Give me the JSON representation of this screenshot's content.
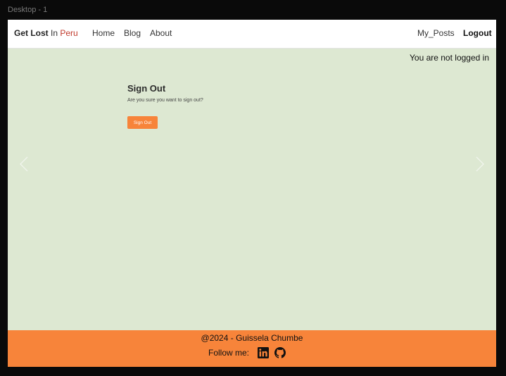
{
  "frame": {
    "label": "Desktop - 1"
  },
  "navbar": {
    "brand_part1": "Get Lost",
    "brand_part2": " In ",
    "brand_part3": "Peru",
    "links": [
      "Home",
      "Blog",
      "About"
    ],
    "my_posts": "My_Posts",
    "logout": "Logout"
  },
  "status_text": "You are not logged in",
  "signout": {
    "title": "Sign Out",
    "message": "Are you sure you want to sign out?",
    "button": "Sign Out"
  },
  "footer": {
    "copyright": "@2024 - Guissela Chumbe",
    "follow": "Follow me:",
    "icons": [
      "linkedin-icon",
      "github-icon"
    ]
  },
  "colors": {
    "accent": "#f7843a",
    "background": "#dde8d2",
    "brand_peru": "#c0392b"
  }
}
